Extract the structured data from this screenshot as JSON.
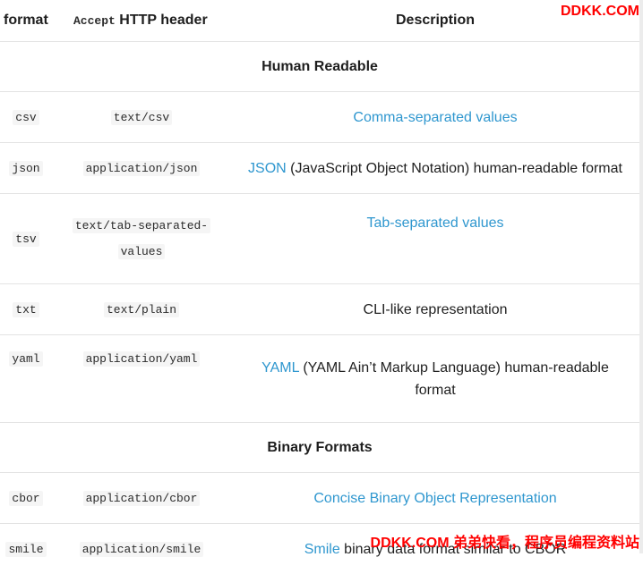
{
  "table": {
    "headers": {
      "format": "format",
      "accept_code": "Accept",
      "accept_text": "HTTP header",
      "description": "Description"
    },
    "sections": [
      {
        "title": "Human Readable",
        "rows": [
          {
            "format": "csv",
            "header": "text/csv",
            "desc_link": "Comma-separated values",
            "desc_rest": ""
          },
          {
            "format": "json",
            "header": "application/json",
            "desc_link": "JSON",
            "desc_rest": " (JavaScript Object Notation) human-readable format"
          },
          {
            "format": "tsv",
            "header_line1": "text/tab-separated-",
            "header_line2": "values",
            "desc_link": "Tab-separated values",
            "desc_rest": ""
          },
          {
            "format": "txt",
            "header": "text/plain",
            "desc_link": "",
            "desc_rest": "CLI-like representation"
          },
          {
            "format": "yaml",
            "header": "application/yaml",
            "desc_link": "YAML",
            "desc_rest": " (YAML Ain’t Markup Language) human-readable format"
          }
        ]
      },
      {
        "title": "Binary Formats",
        "rows": [
          {
            "format": "cbor",
            "header": "application/cbor",
            "desc_link": "Concise Binary Object Representation",
            "desc_rest": ""
          },
          {
            "format": "smile",
            "header": "application/smile",
            "desc_link": "Smile",
            "desc_rest": " binary data format similar to CBOR"
          }
        ]
      }
    ]
  },
  "watermark": {
    "top": "DDKK.COM",
    "bottom": "DDKK.COM 弟弟快看，程序员编程资料站"
  },
  "colors": {
    "link": "#2f97cf",
    "watermark": "#ff0000"
  }
}
